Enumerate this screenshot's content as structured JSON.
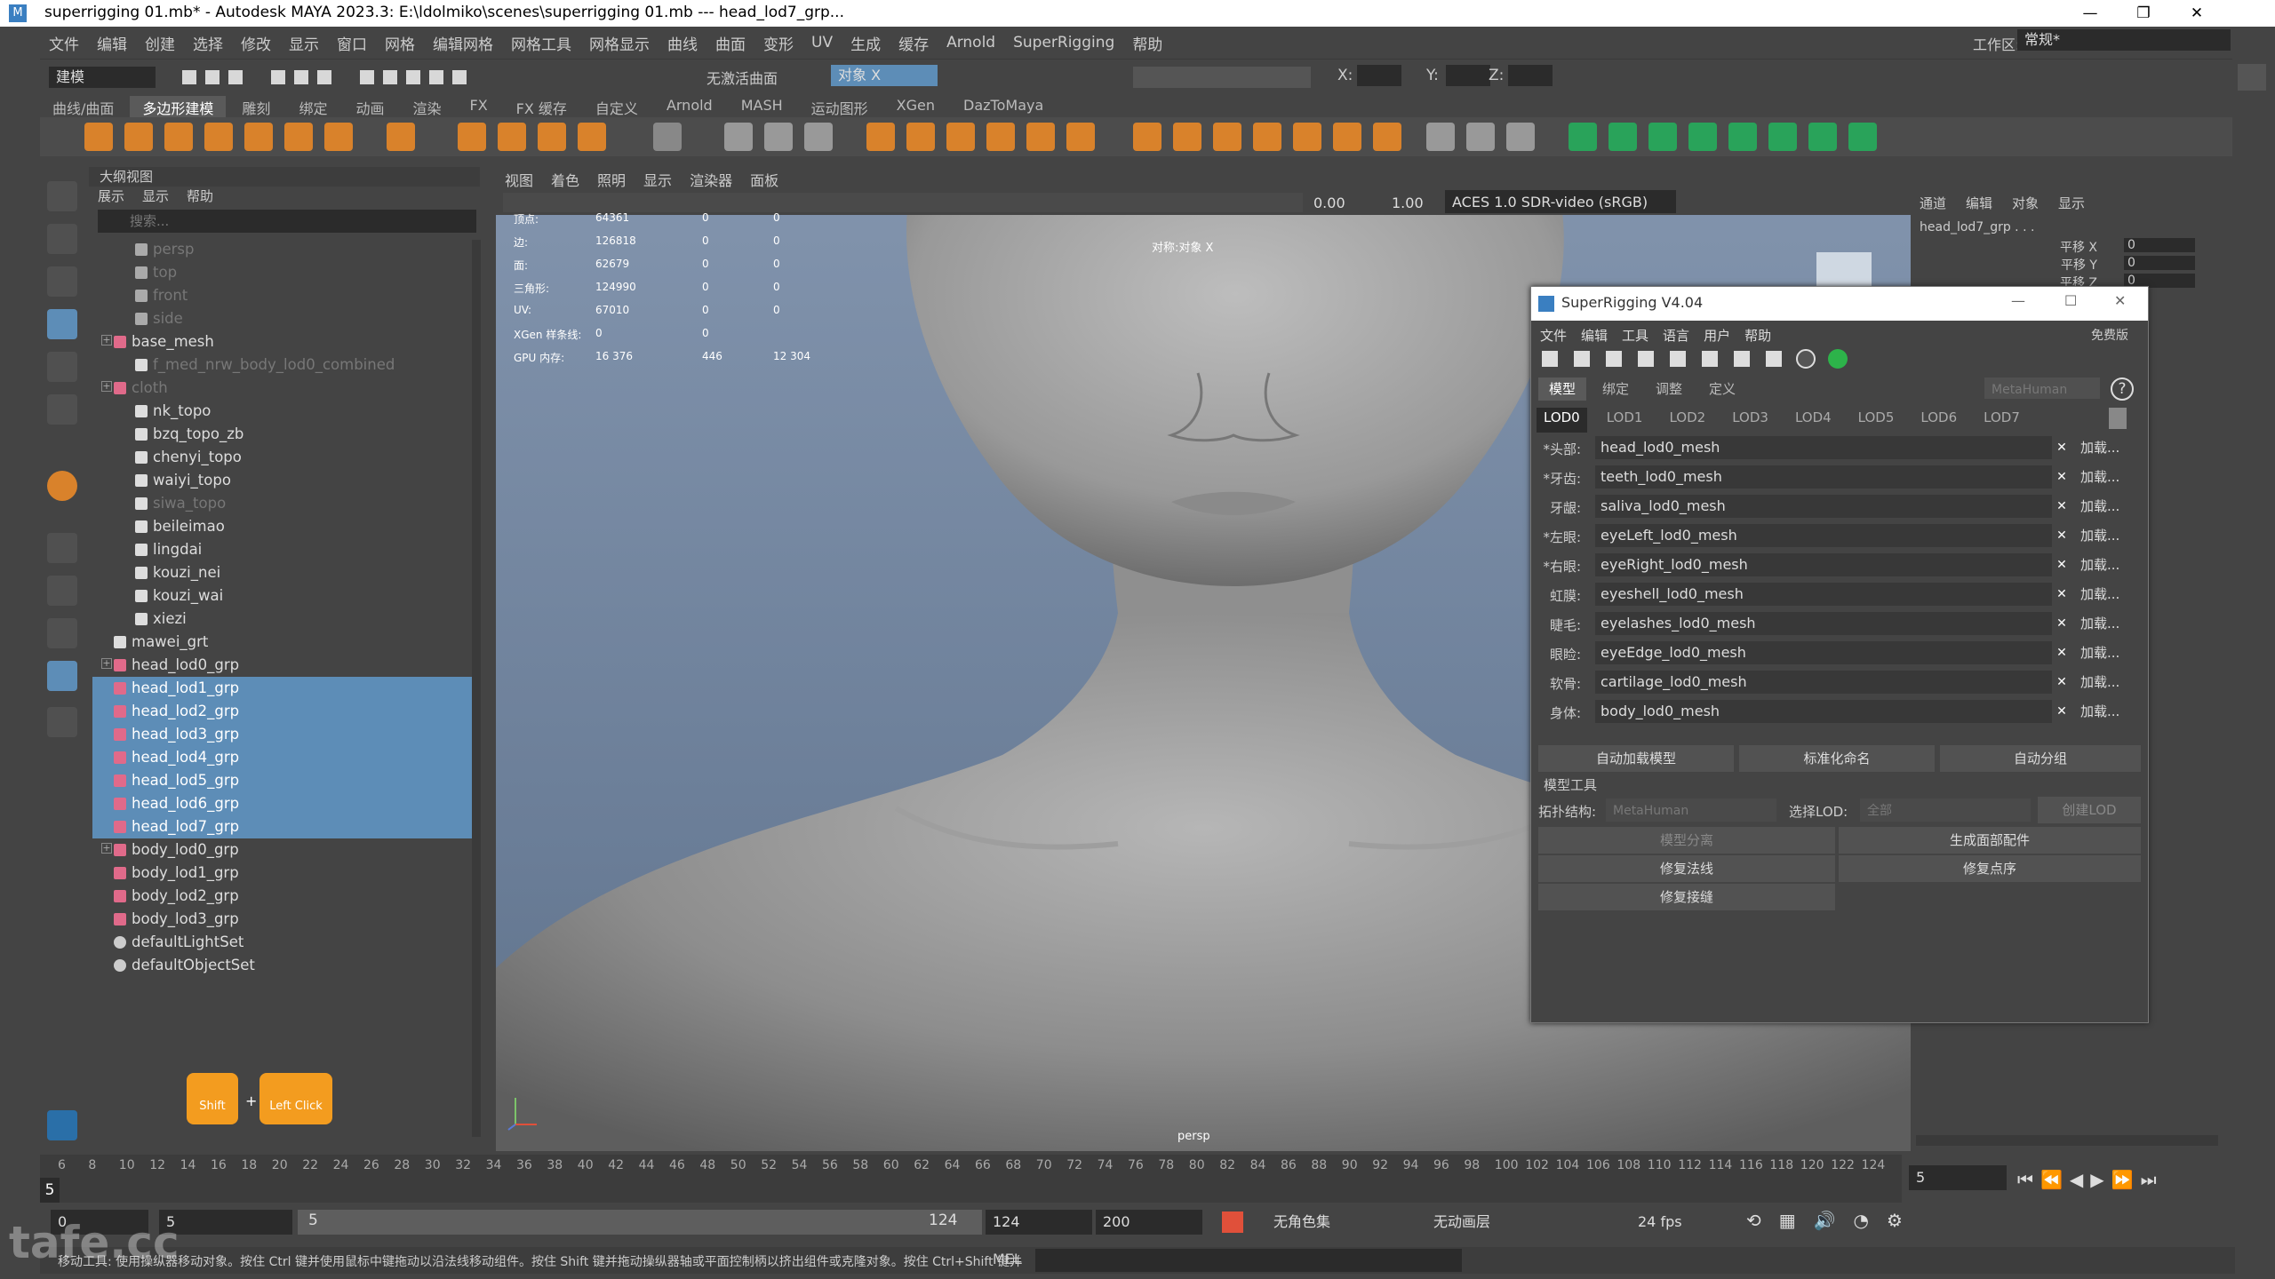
{
  "window": {
    "title": "superrigging 01.mb* - Autodesk MAYA 2023.3: E:\\ldolmiko\\scenes\\superrigging 01.mb   ---   head_lod7_grp..."
  },
  "menubar": [
    "文件",
    "编辑",
    "创建",
    "选择",
    "修改",
    "显示",
    "窗口",
    "网格",
    "编辑网格",
    "网格工具",
    "网格显示",
    "曲线",
    "曲面",
    "变形",
    "UV",
    "生成",
    "缓存",
    "Arnold",
    "SuperRigging",
    "帮助"
  ],
  "statusline": {
    "mode": "建模",
    "no_live": "无激活曲面",
    "object": "对象 X",
    "x": "X:",
    "y": "Y:",
    "z": "Z:",
    "workspace_label": "工作区:",
    "workspace": "常规*"
  },
  "shelf_tabs": [
    "曲线/曲面",
    "多边形建模",
    "雕刻",
    "绑定",
    "动画",
    "渲染",
    "FX",
    "FX 缓存",
    "自定义",
    "Arnold",
    "MASH",
    "运动图形",
    "XGen",
    "DazToMaya"
  ],
  "outliner": {
    "title": "大纲视图",
    "menu": [
      "展示",
      "显示",
      "帮助"
    ],
    "search_placeholder": "搜索...",
    "rows": [
      {
        "label": "persp",
        "indent": 1,
        "dim": true,
        "sel": false,
        "type": "cam"
      },
      {
        "label": "top",
        "indent": 1,
        "dim": true,
        "sel": false,
        "type": "cam"
      },
      {
        "label": "front",
        "indent": 1,
        "dim": true,
        "sel": false,
        "type": "cam"
      },
      {
        "label": "side",
        "indent": 1,
        "dim": true,
        "sel": false,
        "type": "cam"
      },
      {
        "label": "base_mesh",
        "indent": 0,
        "dim": false,
        "sel": false,
        "type": "grp",
        "exp": true
      },
      {
        "label": "f_med_nrw_body_lod0_combined",
        "indent": 1,
        "dim": true,
        "sel": false,
        "type": "mesh"
      },
      {
        "label": "cloth",
        "indent": 0,
        "dim": true,
        "sel": false,
        "type": "grp",
        "exp": true
      },
      {
        "label": "nk_topo",
        "indent": 1,
        "dim": false,
        "sel": false,
        "type": "mesh"
      },
      {
        "label": "bzq_topo_zb",
        "indent": 1,
        "dim": false,
        "sel": false,
        "type": "mesh"
      },
      {
        "label": "chenyi_topo",
        "indent": 1,
        "dim": false,
        "sel": false,
        "type": "mesh"
      },
      {
        "label": "waiyi_topo",
        "indent": 1,
        "dim": false,
        "sel": false,
        "type": "mesh"
      },
      {
        "label": "siwa_topo",
        "indent": 1,
        "dim": true,
        "sel": false,
        "type": "mesh"
      },
      {
        "label": "beileimao",
        "indent": 1,
        "dim": false,
        "sel": false,
        "type": "mesh"
      },
      {
        "label": "lingdai",
        "indent": 1,
        "dim": false,
        "sel": false,
        "type": "mesh"
      },
      {
        "label": "kouzi_nei",
        "indent": 1,
        "dim": false,
        "sel": false,
        "type": "mesh"
      },
      {
        "label": "kouzi_wai",
        "indent": 1,
        "dim": false,
        "sel": false,
        "type": "mesh"
      },
      {
        "label": "xiezi",
        "indent": 1,
        "dim": false,
        "sel": false,
        "type": "mesh"
      },
      {
        "label": "mawei_grt",
        "indent": 0,
        "dim": false,
        "sel": false,
        "type": "mesh"
      },
      {
        "label": "head_lod0_grp",
        "indent": 0,
        "dim": false,
        "sel": false,
        "type": "grp",
        "exp": true
      },
      {
        "label": "head_lod1_grp",
        "indent": 0,
        "dim": false,
        "sel": true,
        "type": "grp"
      },
      {
        "label": "head_lod2_grp",
        "indent": 0,
        "dim": false,
        "sel": true,
        "type": "grp"
      },
      {
        "label": "head_lod3_grp",
        "indent": 0,
        "dim": false,
        "sel": true,
        "type": "grp"
      },
      {
        "label": "head_lod4_grp",
        "indent": 0,
        "dim": false,
        "sel": true,
        "type": "grp"
      },
      {
        "label": "head_lod5_grp",
        "indent": 0,
        "dim": false,
        "sel": true,
        "type": "grp"
      },
      {
        "label": "head_lod6_grp",
        "indent": 0,
        "dim": false,
        "sel": true,
        "type": "grp"
      },
      {
        "label": "head_lod7_grp",
        "indent": 0,
        "dim": false,
        "sel": true,
        "type": "grp"
      },
      {
        "label": "body_lod0_grp",
        "indent": 0,
        "dim": false,
        "sel": false,
        "type": "grp",
        "exp": true
      },
      {
        "label": "body_lod1_grp",
        "indent": 0,
        "dim": false,
        "sel": false,
        "type": "grp"
      },
      {
        "label": "body_lod2_grp",
        "indent": 0,
        "dim": false,
        "sel": false,
        "type": "grp"
      },
      {
        "label": "body_lod3_grp",
        "indent": 0,
        "dim": false,
        "sel": false,
        "type": "grp"
      },
      {
        "label": "defaultLightSet",
        "indent": 0,
        "dim": false,
        "sel": false,
        "type": "set"
      },
      {
        "label": "defaultObjectSet",
        "indent": 0,
        "dim": false,
        "sel": false,
        "type": "set"
      }
    ]
  },
  "keyhint": {
    "shift": "Shift",
    "click": "Left Click",
    "plus": "+"
  },
  "viewport": {
    "menu": [
      "视图",
      "着色",
      "照明",
      "显示",
      "渲染器",
      "面板"
    ],
    "exposure": "0.00",
    "gamma": "1.00",
    "colorspace": "ACES 1.0 SDR-video (sRGB)",
    "hud": [
      {
        "k": "顶点:",
        "a": "64361",
        "b": "0",
        "c": "0"
      },
      {
        "k": "边:",
        "a": "126818",
        "b": "0",
        "c": "0"
      },
      {
        "k": "面:",
        "a": "62679",
        "b": "0",
        "c": "0"
      },
      {
        "k": "三角形:",
        "a": "124990",
        "b": "0",
        "c": "0"
      },
      {
        "k": "UV:",
        "a": "67010",
        "b": "0",
        "c": "0"
      },
      {
        "k": "XGen 样条线:",
        "a": "0",
        "b": "0",
        "c": ""
      },
      {
        "k": "GPU 内存:",
        "a": "16 376",
        "b": "446",
        "c": "12 304"
      }
    ],
    "symmetry": "对称:对象 X",
    "camera": "persp"
  },
  "superrigging": {
    "title": "SuperRigging V4.04",
    "menu": [
      "文件",
      "编辑",
      "工具",
      "语言",
      "用户",
      "帮助"
    ],
    "free": "免费版",
    "tabs": [
      "模型",
      "绑定",
      "调整",
      "定义"
    ],
    "preset": "MetaHuman",
    "lods": [
      "LOD0",
      "LOD1",
      "LOD2",
      "LOD3",
      "LOD4",
      "LOD5",
      "LOD6",
      "LOD7"
    ],
    "rows": [
      {
        "k": "*头部:",
        "v": "head_lod0_mesh"
      },
      {
        "k": "*牙齿:",
        "v": "teeth_lod0_mesh"
      },
      {
        "k": "牙龈:",
        "v": "saliva_lod0_mesh"
      },
      {
        "k": "*左眼:",
        "v": "eyeLeft_lod0_mesh"
      },
      {
        "k": "*右眼:",
        "v": "eyeRight_lod0_mesh"
      },
      {
        "k": "虹膜:",
        "v": "eyeshell_lod0_mesh"
      },
      {
        "k": "睫毛:",
        "v": "eyelashes_lod0_mesh"
      },
      {
        "k": "眼睑:",
        "v": "eyeEdge_lod0_mesh"
      },
      {
        "k": "软骨:",
        "v": "cartilage_lod0_mesh"
      },
      {
        "k": "身体:",
        "v": "body_lod0_mesh"
      }
    ],
    "load": "加载...",
    "auto_load": "自动加载模型",
    "std_name": "标准化命名",
    "auto_group": "自动分组",
    "tools_title": "模型工具",
    "topo_label": "拓扑结构:",
    "topo_value": "MetaHuman",
    "lod_label": "选择LOD:",
    "lod_value": "全部",
    "create_lod": "创建LOD",
    "split": "模型分离",
    "gen_part": "生成面部配件",
    "fix_normal": "修复法线",
    "fix_order": "修复点序",
    "fix_seam": "修复接缝"
  },
  "channelbox": {
    "tabs": [
      "通道",
      "编辑",
      "对象",
      "显示"
    ],
    "object": "head_lod7_grp . . .",
    "attrs": [
      {
        "k": "平移 X",
        "v": "0"
      },
      {
        "k": "平移 Y",
        "v": "0"
      },
      {
        "k": "平移 Z",
        "v": "0"
      }
    ]
  },
  "timeline": {
    "ticks": [
      6,
      8,
      10,
      12,
      14,
      16,
      18,
      20,
      22,
      24,
      26,
      28,
      30,
      32,
      34,
      36,
      38,
      40,
      42,
      44,
      46,
      48,
      50,
      52,
      54,
      56,
      58,
      60,
      62,
      64,
      66,
      68,
      70,
      72,
      74,
      76,
      78,
      80,
      82,
      84,
      86,
      88,
      90,
      92,
      94,
      96,
      98,
      100,
      102,
      104,
      106,
      108,
      110,
      112,
      114,
      116,
      118,
      120,
      122,
      124
    ],
    "current": "5"
  },
  "range": {
    "start": "0",
    "inner_start": "5",
    "slider_start": "5",
    "slider_end": "124",
    "end": "124",
    "outer_end": "200",
    "charset": "无角色集",
    "layer": "无动画层",
    "fps": "24 fps",
    "frame": "5"
  },
  "helpline": {
    "lang": "MEL",
    "text": "移动工具: 使用操纵器移动对象。按住 Ctrl 键并使用鼠标中键拖动以沿法线移动组件。按住 Shift 键并拖动操纵器轴或平面控制柄以挤出组件或克隆对象。按住 Ctrl+Shift 键并"
  },
  "watermark": "tafe.cc"
}
